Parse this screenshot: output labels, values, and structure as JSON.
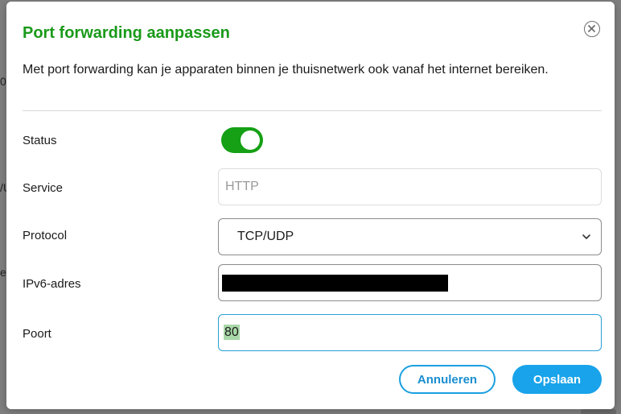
{
  "background": {
    "fragment_a": "0",
    "fragment_b": "/U",
    "fragment_c": "e"
  },
  "dialog": {
    "title": "Port forwarding aanpassen",
    "intro": "Met port forwarding kan je apparaten binnen je thuisnetwerk ook vanaf het internet bereiken.",
    "close_icon": "close-circle-icon"
  },
  "form": {
    "status": {
      "label": "Status",
      "enabled": true
    },
    "service": {
      "label": "Service",
      "placeholder": "HTTP",
      "value": ""
    },
    "protocol": {
      "label": "Protocol",
      "selected": "TCP/UDP"
    },
    "ipv6": {
      "label": "IPv6-adres",
      "value_redacted": true
    },
    "port": {
      "label": "Poort",
      "value": "80"
    }
  },
  "actions": {
    "cancel_label": "Annuleren",
    "save_label": "Opslaan"
  },
  "colors": {
    "title_green": "#1a9a1a",
    "toggle_on": "#15a015",
    "accent_blue": "#18a3ea"
  }
}
